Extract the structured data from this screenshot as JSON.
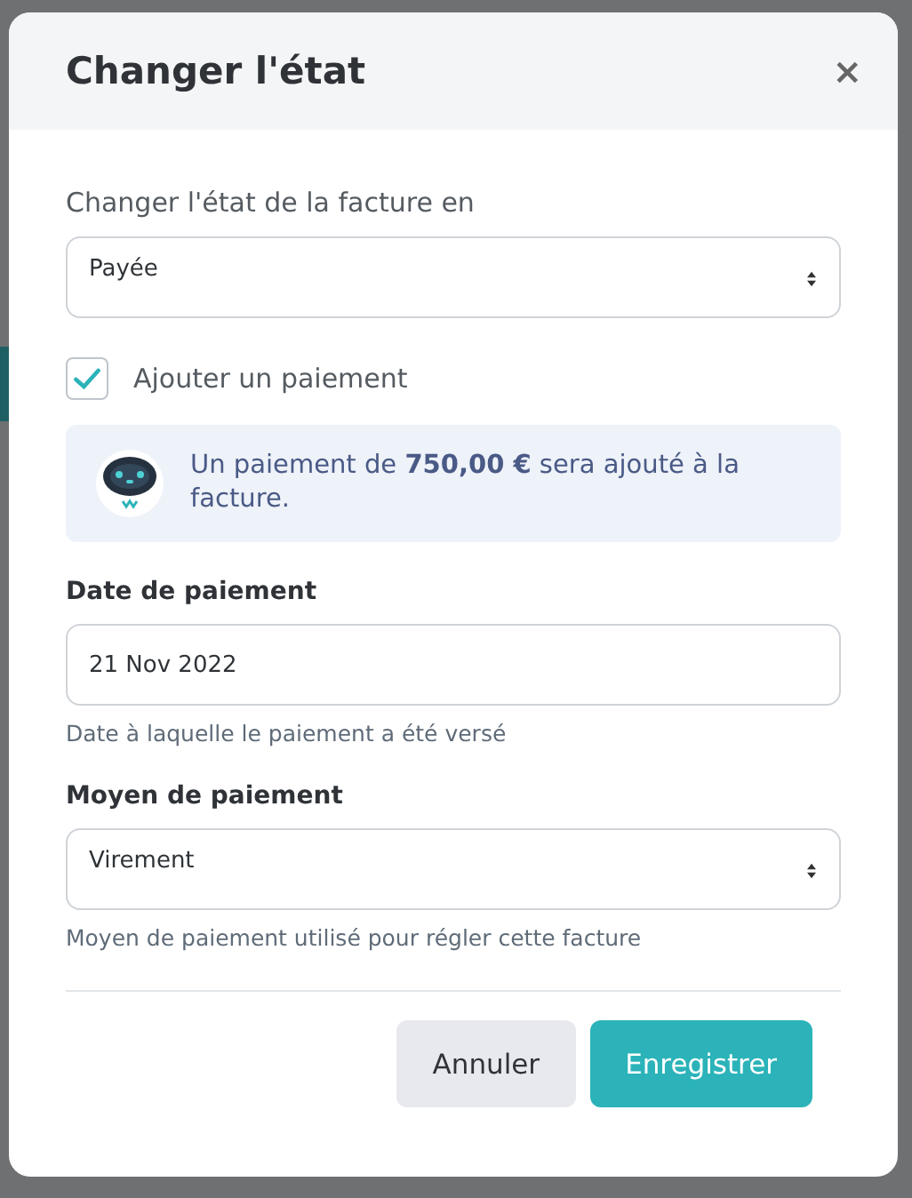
{
  "dialog": {
    "title": "Changer l'état",
    "close": "×",
    "state_label": "Changer l'état de la facture en",
    "state_value": "Payée",
    "add_payment": {
      "label": "Ajouter un paiement",
      "checked": true
    },
    "info": "Un paiement de **750,00 €** sera ajouté à la facture.",
    "date": {
      "label": "Date de paiement",
      "value": "21 Nov 2022",
      "help": "Date à laquelle le paiement a été versé"
    },
    "method": {
      "label": "Moyen de paiement",
      "value": "Virement",
      "help": "Moyen de paiement utilisé pour régler cette facture"
    },
    "buttons": [
      {
        "label": "Annuler",
        "kind": "secondary"
      },
      {
        "label": "Enregistrer",
        "kind": "primary"
      }
    ]
  }
}
